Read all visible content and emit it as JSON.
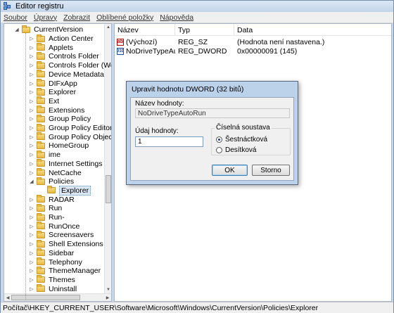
{
  "window": {
    "title": "Editor registru"
  },
  "menu": [
    "Soubor",
    "Úpravy",
    "Zobrazit",
    "Oblíbené položky",
    "Nápověda"
  ],
  "tree": {
    "parent": "CurrentVersion",
    "items": [
      "Action Center",
      "Applets",
      "Controls Folder",
      "Controls Folder (Wow",
      "Device Metadata",
      "DIFxApp",
      "Explorer",
      "Ext",
      "Extensions",
      "Group Policy",
      "Group Policy Editor",
      "Group Policy Objects",
      "HomeGroup",
      "ime",
      "Internet Settings",
      "NetCache",
      "Policies"
    ],
    "selected_child": "Explorer",
    "items_after": [
      "RADAR",
      "Run",
      "Run-",
      "RunOnce",
      "Screensavers",
      "Shell Extensions",
      "Sidebar",
      "Telephony",
      "ThemeManager",
      "Themes",
      "Uninstall"
    ]
  },
  "list": {
    "columns": [
      "Název",
      "Typ",
      "Data"
    ],
    "rows": [
      {
        "icon": "string-value-icon",
        "icon_glyph": "ab",
        "name": "(Výchozí)",
        "type": "REG_SZ",
        "data": "(Hodnota není nastavena.)"
      },
      {
        "icon": "binary-value-icon",
        "icon_glyph": "010",
        "name": "NoDriveTypeAu...",
        "type": "REG_DWORD",
        "data": "0x00000091 (145)"
      }
    ]
  },
  "dialog": {
    "title": "Upravit hodnotu DWORD (32 bitů)",
    "name_label": "Název hodnoty:",
    "name_value": "NoDriveTypeAutoRun",
    "value_label": "Údaj hodnoty:",
    "value": "1",
    "base_label": "Číselná soustava",
    "base_options": [
      "Šestnáctková",
      "Desítková"
    ],
    "base_selected": "Šestnáctková",
    "ok_label": "OK",
    "cancel_label": "Storno"
  },
  "status": "Počítač\\HKEY_CURRENT_USER\\Software\\Microsoft\\Windows\\CurrentVersion\\Policies\\Explorer",
  "colors": {
    "window_frame": "#c7d8ec",
    "dialog_frame": "#bcd1ea",
    "folder": "#e8b93f"
  }
}
